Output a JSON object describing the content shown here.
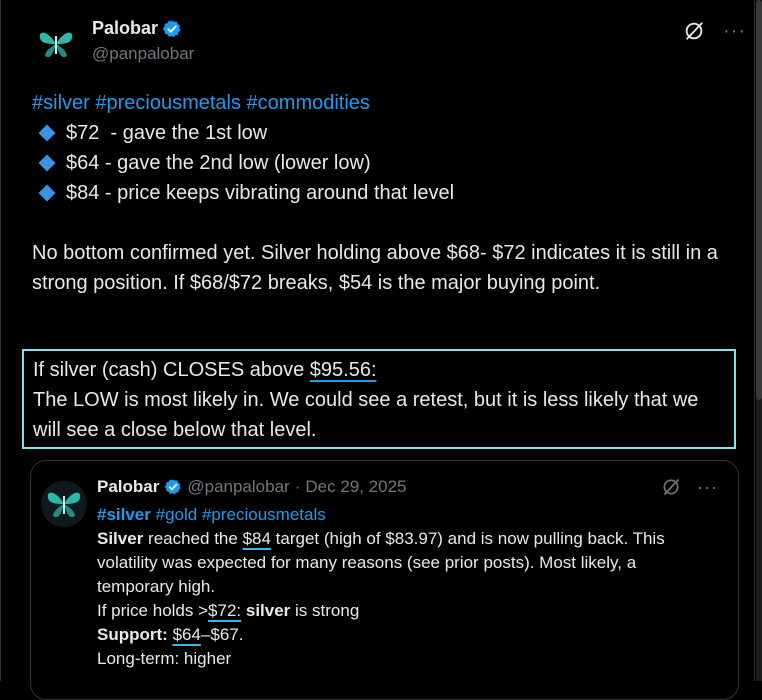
{
  "author": {
    "display_name": "Palobar",
    "handle": "@panpalobar",
    "verified": true
  },
  "tweet": {
    "hashtags": [
      "#silver",
      "#preciousmetals",
      "#commodities"
    ],
    "bullets": [
      "$72  - gave the 1st low",
      "$64 - gave the 2nd low (lower low)",
      "$84 - price keeps vibrating around that level"
    ],
    "paragraph": "No bottom confirmed yet. Silver holding above $68- $72 indicates it is still in a strong position. If $68/$72 breaks, $54 is the major buying point.",
    "highlight": {
      "prefix": "If silver (cash) CLOSES above ",
      "price": "$95.56:",
      "rest": "The LOW is most likely in. We could see a retest, but it is less likely that we will see a close below that level."
    }
  },
  "quoted_tweet": {
    "display_name": "Palobar",
    "handle": "@panpalobar",
    "separator": "·",
    "date": "Dec 29, 2025",
    "hashtags": [
      "#silver",
      "#gold",
      "#preciousmetals"
    ],
    "line1": {
      "bold_word": "Silver",
      "text_a": " reached the ",
      "price": "$84",
      "text_b": " target (high of $83.97) and is now pulling back. This volatility was expected for many reasons (see prior posts). Most likely, a temporary high."
    },
    "line2": {
      "text_a": "If price holds >",
      "price": "$72:",
      "text_b": " ",
      "bold_word": "silver",
      "text_c": " is strong"
    },
    "line3": {
      "bold_label": "Support:",
      "space": " ",
      "price": "$64",
      "rest": "–$67."
    },
    "line4": "Long-term: higher"
  },
  "icons": {
    "verified": "verified-badge-icon",
    "grok": "grok-icon",
    "more": "more-options-icon"
  },
  "colors": {
    "accent": "#1d9bf0",
    "highlight_border": "#7fe3ea",
    "bullet_diamond": "#3b93e6",
    "background": "#000000",
    "text": "#e7e9ea",
    "muted": "#71767b"
  }
}
